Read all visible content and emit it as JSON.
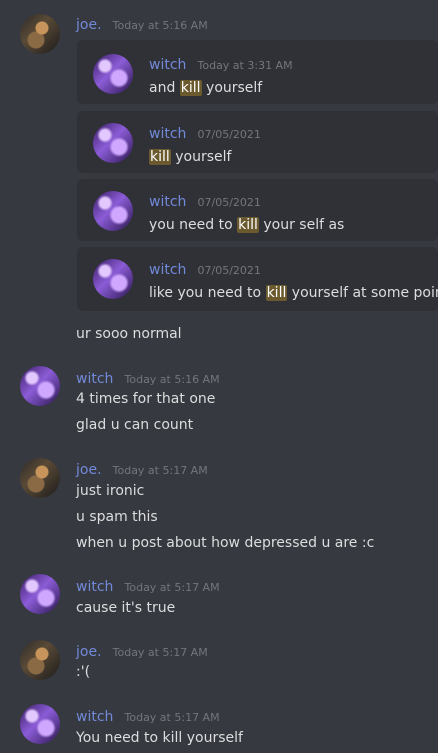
{
  "messages": {
    "m1": {
      "author": "joe.",
      "time": "Today at 5:16 AM"
    },
    "q1": {
      "author": "witch",
      "time": "Today at 3:31 AM",
      "pre": "and ",
      "hl": "kill",
      "post": " yourself"
    },
    "q2": {
      "author": "witch",
      "time": "07/05/2021",
      "pre": "",
      "hl": "kill",
      "post": " yourself"
    },
    "q3": {
      "author": "witch",
      "time": "07/05/2021",
      "pre": "you need to ",
      "hl": "kill",
      "post": " your self as"
    },
    "q4": {
      "author": "witch",
      "time": "07/05/2021",
      "pre": "like you need to ",
      "hl": "kill",
      "post": " yourself at some point"
    },
    "m1_text": "ur sooo normal",
    "m2": {
      "author": "witch",
      "time": "Today at 5:16 AM",
      "lines": [
        "4 times for that one",
        "glad u can count"
      ]
    },
    "m3": {
      "author": "joe.",
      "time": "Today at 5:17 AM",
      "lines": [
        "just ironic",
        "u spam this",
        "when u post about how depressed u are :c"
      ]
    },
    "m4": {
      "author": "witch",
      "time": "Today at 5:17 AM",
      "lines": [
        "cause it's true"
      ]
    },
    "m5": {
      "author": "joe.",
      "time": "Today at 5:17 AM",
      "lines": [
        ":'("
      ]
    },
    "m6": {
      "author": "witch",
      "time": "Today at 5:17 AM",
      "lines": [
        "You need to kill yourself"
      ]
    }
  },
  "colors": {
    "background": "#36393f",
    "card": "#2f3136",
    "username": "#7289da",
    "timestamp": "#72767d",
    "highlight": "#6b5a2e"
  },
  "icons": {
    "joe_avatar": "joe-avatar-image",
    "witch_avatar": "witch-avatar-image"
  }
}
